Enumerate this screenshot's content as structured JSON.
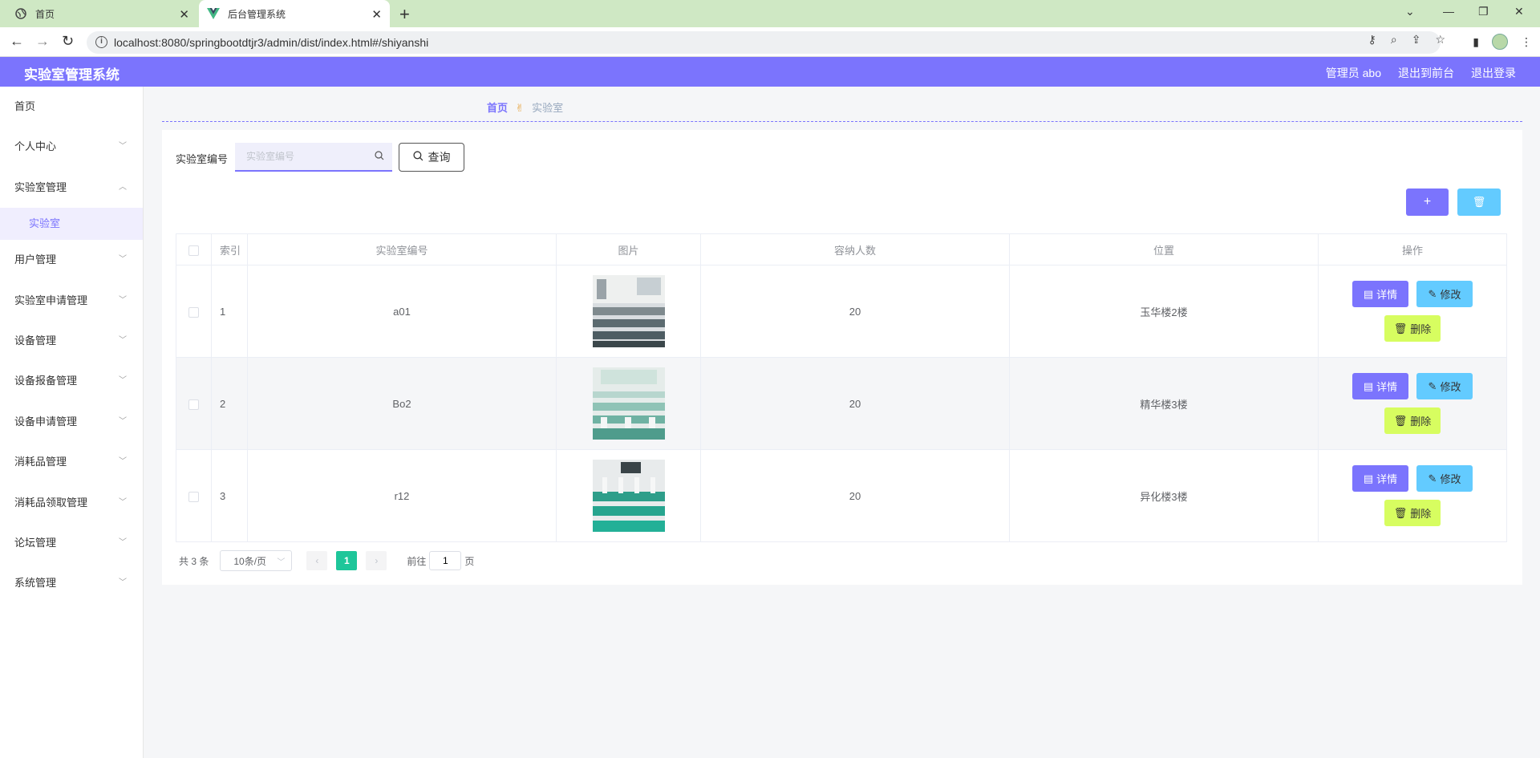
{
  "browser": {
    "tabs": [
      {
        "title": "首页",
        "active": false
      },
      {
        "title": "后台管理系统",
        "active": true
      }
    ],
    "url": "localhost:8080/springbootdtjr3/admin/dist/index.html#/shiyanshi"
  },
  "header": {
    "title": "实验室管理系统",
    "user": "管理员 abo",
    "to_front": "退出到前台",
    "logout": "退出登录",
    "color": "#7b74fd"
  },
  "sidebar": {
    "items": [
      {
        "label": "首页",
        "chevron": ""
      },
      {
        "label": "个人中心",
        "chevron": "down"
      },
      {
        "label": "实验室管理",
        "chevron": "up"
      },
      {
        "label": "用户管理",
        "chevron": "down"
      },
      {
        "label": "实验室申请管理",
        "chevron": "down"
      },
      {
        "label": "设备管理",
        "chevron": "down"
      },
      {
        "label": "设备报备管理",
        "chevron": "down"
      },
      {
        "label": "设备申请管理",
        "chevron": "down"
      },
      {
        "label": "消耗品管理",
        "chevron": "down"
      },
      {
        "label": "消耗品领取管理",
        "chevron": "down"
      },
      {
        "label": "论坛管理",
        "chevron": "down"
      },
      {
        "label": "系统管理",
        "chevron": "down"
      }
    ],
    "active_sub": "实验室"
  },
  "breadcrumb": {
    "home": "首页",
    "current": "实验室"
  },
  "search": {
    "label": "实验室编号",
    "placeholder": "实验室编号",
    "value": "",
    "button": "查询"
  },
  "table": {
    "headers": [
      "",
      "索引",
      "实验室编号",
      "图片",
      "容纳人数",
      "位置",
      "操作"
    ],
    "rows": [
      {
        "index": "1",
        "code": "a01",
        "image": "lab-photo-1",
        "capacity": "20",
        "location": "玉华楼2楼"
      },
      {
        "index": "2",
        "code": "Bo2",
        "image": "lab-photo-2",
        "capacity": "20",
        "location": "精华楼3楼"
      },
      {
        "index": "3",
        "code": "r12",
        "image": "lab-photo-3",
        "capacity": "20",
        "location": "异化楼3楼"
      }
    ],
    "actions": {
      "detail": "详情",
      "edit": "修改",
      "delete": "删除"
    }
  },
  "pagination": {
    "total": "共 3 条",
    "page_size": "10条/页",
    "current_page": "1",
    "goto_prefix": "前往",
    "goto_value": "1",
    "goto_suffix": "页"
  },
  "colors": {
    "primary": "#7b74fd",
    "edit": "#63cbff",
    "delete": "#d7fd60",
    "page_active": "#1ec69a"
  }
}
